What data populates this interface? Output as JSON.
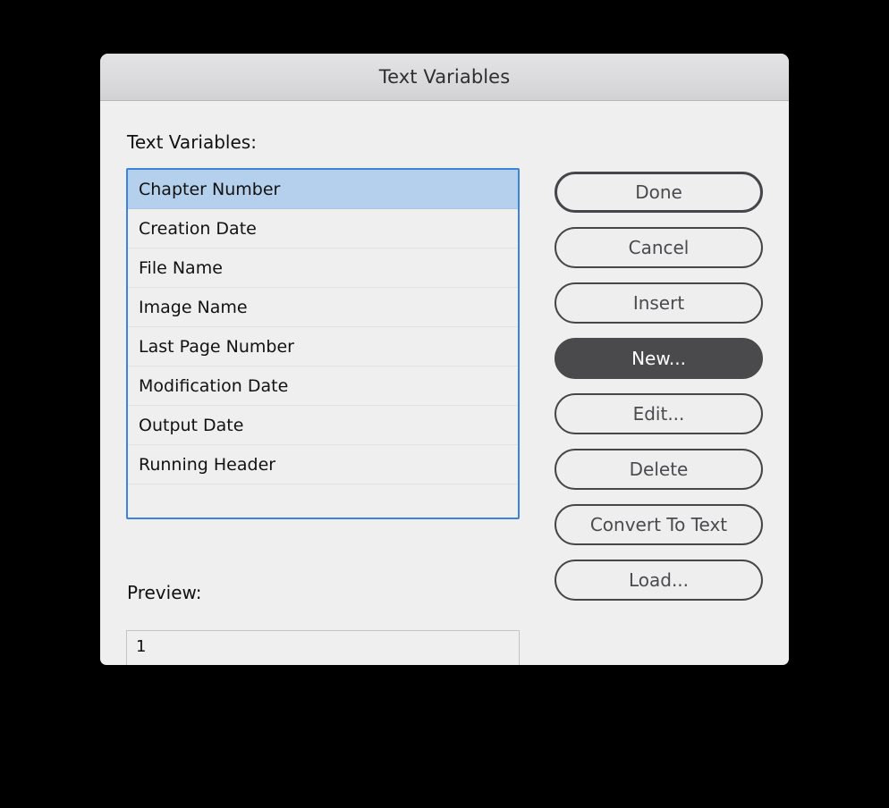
{
  "dialog": {
    "title": "Text Variables"
  },
  "labels": {
    "text_variables": "Text Variables:",
    "preview": "Preview:"
  },
  "list": {
    "selected_index": 0,
    "items": [
      {
        "label": "Chapter Number"
      },
      {
        "label": "Creation Date"
      },
      {
        "label": "File Name"
      },
      {
        "label": "Image Name"
      },
      {
        "label": "Last Page Number"
      },
      {
        "label": "Modification Date"
      },
      {
        "label": "Output Date"
      },
      {
        "label": "Running Header"
      }
    ]
  },
  "preview": {
    "value": "1"
  },
  "buttons": [
    {
      "label": "Done"
    },
    {
      "label": "Cancel"
    },
    {
      "label": "Insert"
    },
    {
      "label": "New..."
    },
    {
      "label": "Edit..."
    },
    {
      "label": "Delete"
    },
    {
      "label": "Convert To Text"
    },
    {
      "label": "Load..."
    }
  ],
  "colors": {
    "dialog_background": "#efefef",
    "titlebar_top": "#e3e3e4",
    "titlebar_bottom": "#d2d2d5",
    "selection_blue": "#b4d0ec",
    "focus_border_blue": "#3d83d8",
    "primary_button": "#4a4a4c",
    "button_border": "#45454a",
    "text": "#111111"
  }
}
